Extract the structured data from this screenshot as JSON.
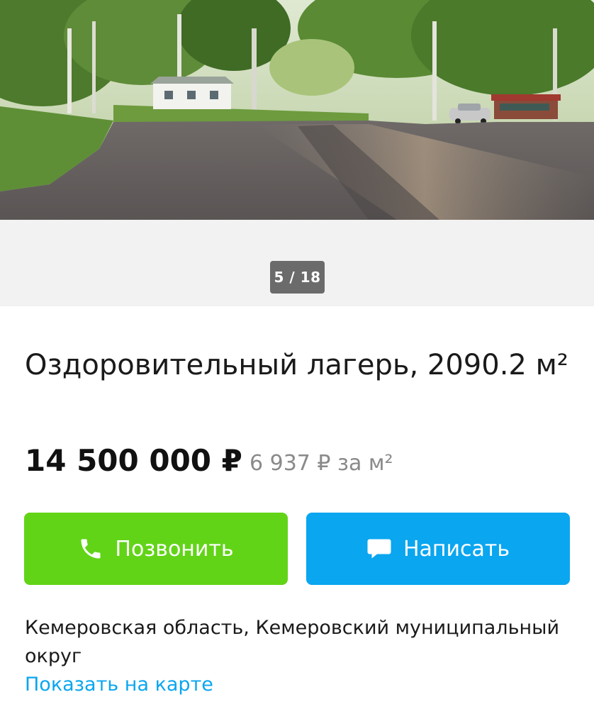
{
  "gallery": {
    "counter": "5 / 18"
  },
  "listing": {
    "title": "Оздоровительный лагерь, 2090.2 м²",
    "price": "14 500 000 ₽",
    "price_per_sqm": "6 937 ₽ за м²"
  },
  "actions": {
    "call_label": "Позвонить",
    "call_icon": "phone-icon",
    "call_color": "#62d418",
    "write_label": "Написать",
    "write_icon": "chat-bubble-icon",
    "write_color": "#0aa6f0"
  },
  "location": {
    "address": "Кемеровская область, Кемеровский муниципальный округ",
    "map_link": "Показать на карте",
    "link_color": "#0aa6f0"
  }
}
